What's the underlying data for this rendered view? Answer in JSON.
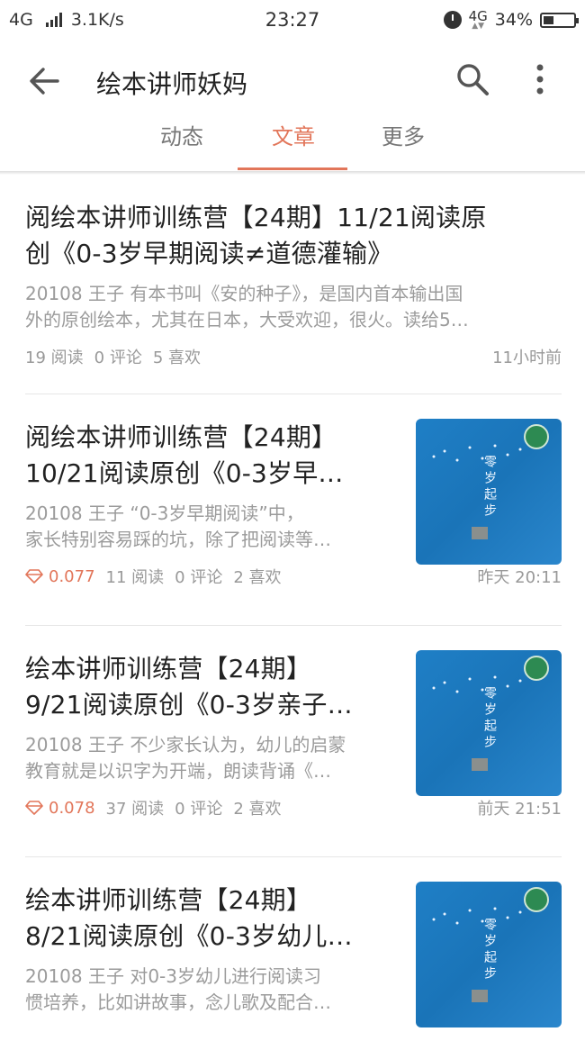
{
  "status_bar": {
    "network": "4G",
    "speed": "3.1K/s",
    "time": "23:27",
    "network_right": "4G",
    "battery": "34%"
  },
  "header": {
    "title": "绘本讲师妖妈"
  },
  "tabs": [
    {
      "label": "动态"
    },
    {
      "label": "文章"
    },
    {
      "label": "更多"
    }
  ],
  "active_tab": "文章",
  "accent_color": "#e2765a",
  "articles": [
    {
      "title_line1": "阅绘本讲师训练营【24期】11/21阅读原",
      "title_line2": "创《0-3岁早期阅读≠道德灌输》",
      "summary_line1": "20108 王子 有本书叫《安的种子》，是国内首本输出国",
      "summary_line2": "外的原创绘本，尤其在日本，大受欢迎，很火。读给5…",
      "reads": "19 阅读",
      "comments": "0 评论",
      "likes": "5 喜欢",
      "time": "11小时前"
    },
    {
      "title_line1": "阅绘本讲师训练营【24期】",
      "title_line2": "10/21阅读原创《0-3岁早…",
      "summary_line1": "20108 王子 “0-3岁早期阅读”中，",
      "summary_line2": "家长特别容易踩的坑，除了把阅读等…",
      "reward": "0.077",
      "reads": "11 阅读",
      "comments": "0 评论",
      "likes": "2 喜欢",
      "time": "昨天 20:11",
      "thumb_text": "零岁起步"
    },
    {
      "title_line1": "绘本讲师训练营【24期】",
      "title_line2": "9/21阅读原创《0-3岁亲子…",
      "summary_line1": "20108 王子 不少家长认为，幼儿的启蒙",
      "summary_line2": "教育就是以识字为开端，朗读背诵《…",
      "reward": "0.078",
      "reads": "37 阅读",
      "comments": "0 评论",
      "likes": "2 喜欢",
      "time": "前天 21:51",
      "thumb_text": "零岁起步"
    },
    {
      "title_line1": "绘本讲师训练营【24期】",
      "title_line2": "8/21阅读原创《0-3岁幼儿…",
      "summary_line1": "20108 王子 对0-3岁幼儿进行阅读习",
      "summary_line2": "惯培养，比如讲故事，念儿歌及配合…",
      "thumb_text": "零岁起步"
    }
  ]
}
